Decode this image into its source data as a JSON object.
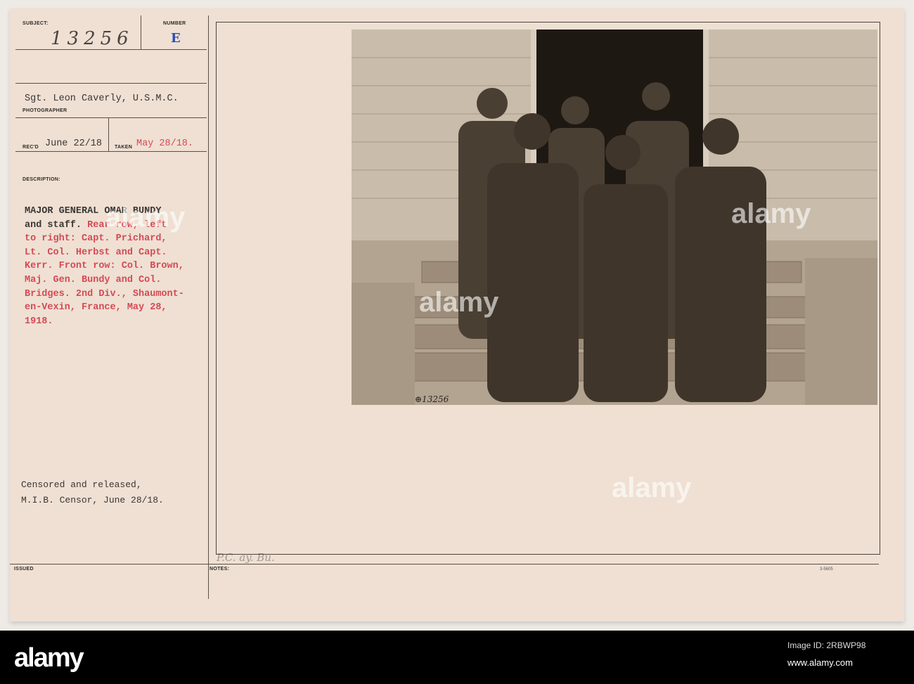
{
  "card": {
    "subject_label": "SUBJECT:",
    "subject_number": "13256",
    "number_label": "NUMBER",
    "number_value": "E",
    "photographer": "Sgt. Leon Caverly, U.S.M.C.",
    "photographer_label": "PHOTOGRAPHER",
    "recd_label": "REC'D",
    "recd_date": "June 22/18",
    "taken_label": "TAKEN",
    "taken_date": "May 28/18.",
    "description_label": "DESCRIPTION:",
    "description_lines": [
      "MAJOR GENERAL OMAR BUNDY",
      "and staff.",
      " Rear row, left",
      "to right: Capt. Prichard,",
      "Lt. Col. Herbst and Capt.",
      "Kerr. Front row: Col. Brown,",
      "Maj. Gen. Bundy and Col.",
      "Bridges. 2nd Div., Shaumont-",
      "en-Vexin, France, May 28,",
      "1918."
    ],
    "censor_line1": "Censored and released,",
    "censor_line2": "M.I.B. Censor, June 28/18.",
    "issued_label": "ISSUED",
    "notes_label": "NOTES:",
    "notes_handwriting": "P.C. ay. Bu.",
    "form_number": "3-5605",
    "photo_inscription": "13256"
  },
  "footer": {
    "logo": "alamy",
    "image_id": "Image ID: 2RBWP98",
    "url": "www.alamy.com"
  },
  "watermark": "alamy"
}
